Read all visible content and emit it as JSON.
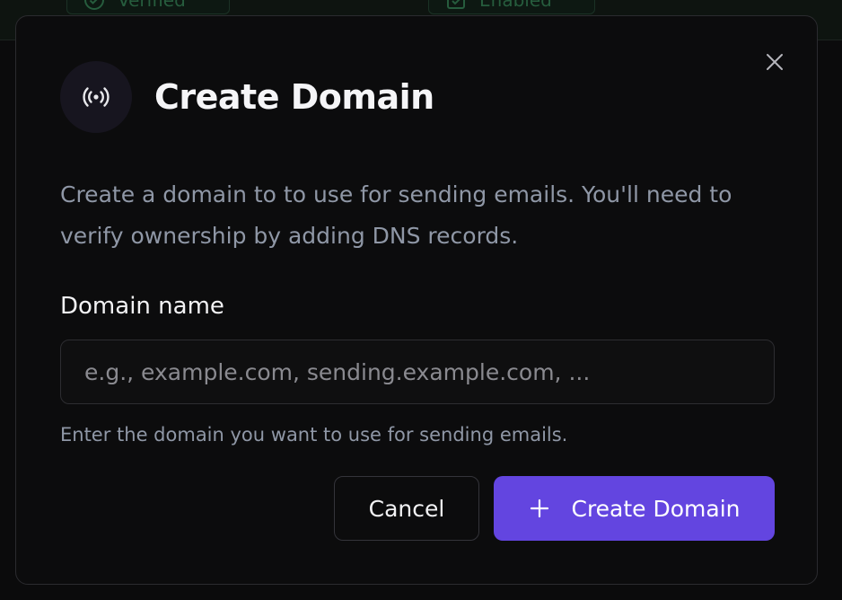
{
  "background": {
    "badges": [
      {
        "label": "Verified",
        "icon": "check-circle-icon"
      },
      {
        "label": "Enabled",
        "icon": "calendar-check-icon"
      }
    ]
  },
  "modal": {
    "header_icon": "broadcast-icon",
    "title": "Create Domain",
    "description": "Create a domain to to use for sending emails. You'll need to verify ownership by adding DNS records.",
    "close_icon": "close-icon",
    "field": {
      "label": "Domain name",
      "value": "",
      "placeholder": "e.g., example.com, sending.example.com, ...",
      "helper": "Enter the domain you want to use for sending emails."
    },
    "actions": {
      "cancel_label": "Cancel",
      "create_label": "Create Domain",
      "create_icon": "plus-icon"
    }
  },
  "colors": {
    "accent": "#6345e0",
    "surface": "#0c0c0d",
    "border": "#2b2b2f",
    "muted_text": "#8f97a6"
  }
}
